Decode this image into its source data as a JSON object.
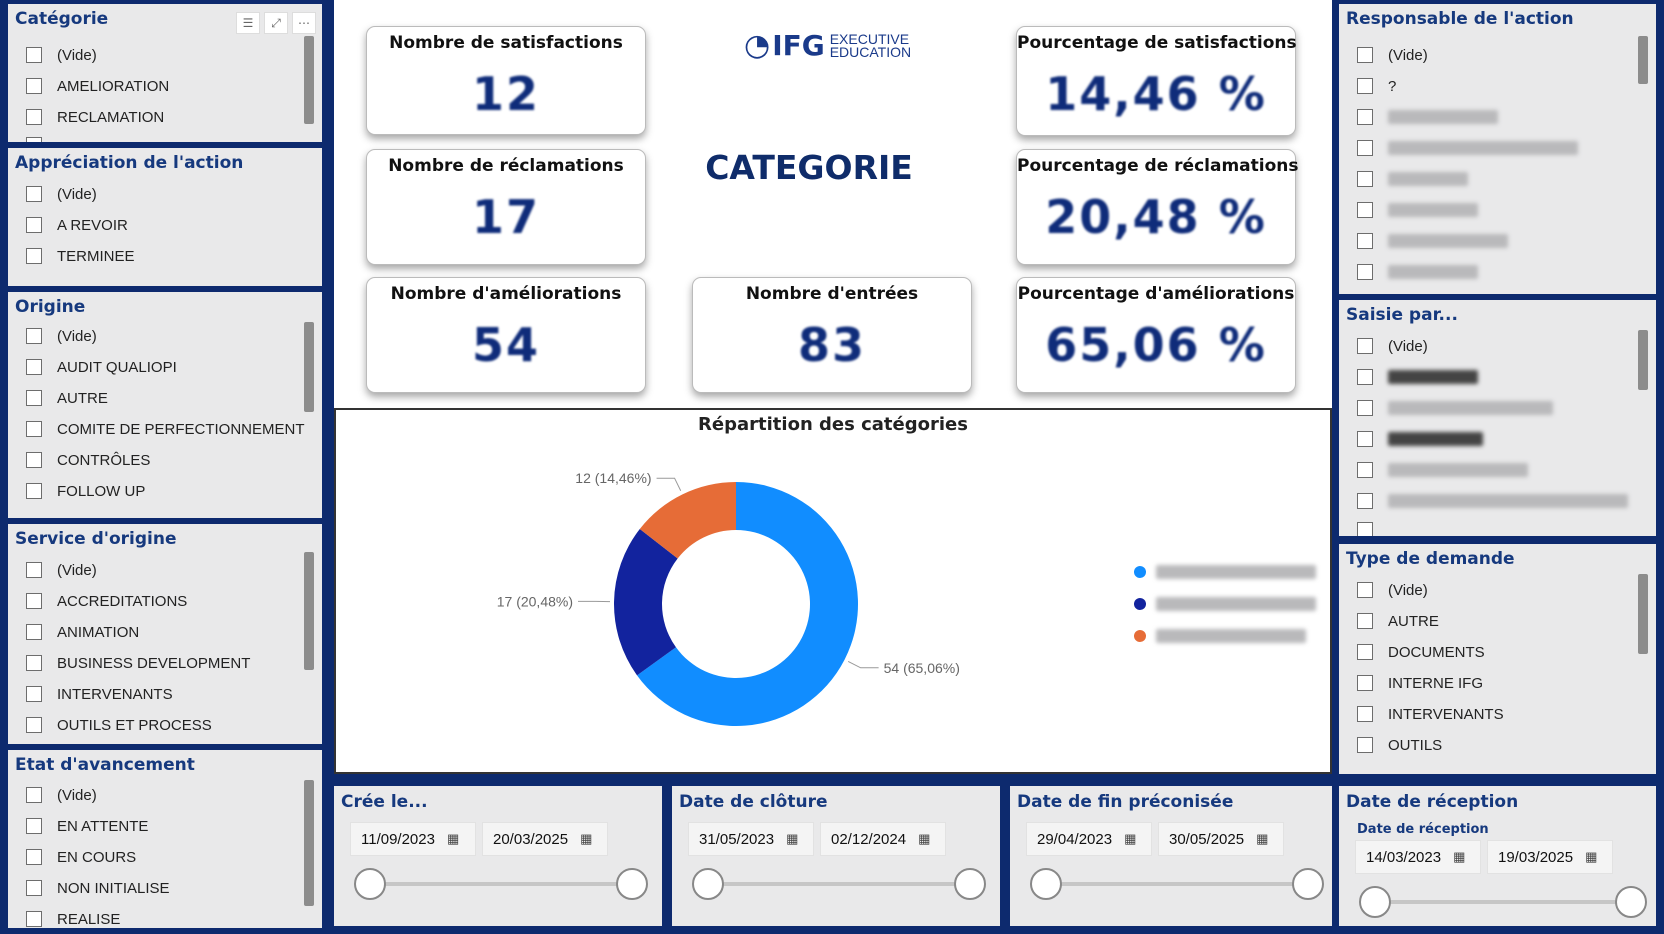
{
  "slicers": {
    "categorie": {
      "title": "Catégorie",
      "items": [
        "(Vide)",
        "AMELIORATION",
        "RECLAMATION"
      ]
    },
    "appreciation": {
      "title": "Appréciation de l'action",
      "items": [
        "(Vide)",
        "A REVOIR",
        "TERMINEE"
      ]
    },
    "origine": {
      "title": "Origine",
      "items": [
        "(Vide)",
        "AUDIT QUALIOPI",
        "AUTRE",
        "COMITE DE PERFECTIONNEMENT",
        "CONTRÔLES",
        "FOLLOW UP"
      ]
    },
    "service": {
      "title": "Service d'origine",
      "items": [
        "(Vide)",
        "ACCREDITATIONS",
        "ANIMATION",
        "BUSINESS DEVELOPMENT",
        "INTERVENANTS",
        "OUTILS ET PROCESS"
      ]
    },
    "etat": {
      "title": "Etat d'avancement",
      "items": [
        "(Vide)",
        "EN ATTENTE",
        "EN COURS",
        "NON INITIALISE",
        "REALISE"
      ]
    },
    "responsable": {
      "title": "Responsable de l'action",
      "items": [
        "(Vide)",
        "?"
      ]
    },
    "saisie": {
      "title": "Saisie par...",
      "items": [
        "(Vide)"
      ]
    },
    "type": {
      "title": "Type de demande",
      "items": [
        "(Vide)",
        "AUTRE",
        "DOCUMENTS",
        "INTERNE IFG",
        "INTERVENANTS",
        "OUTILS"
      ]
    }
  },
  "kpis": {
    "satisfactions": {
      "title": "Nombre de satisfactions",
      "value": "12"
    },
    "reclamations": {
      "title": "Nombre de réclamations",
      "value": "17"
    },
    "ameliorations": {
      "title": "Nombre d'améliorations",
      "value": "54"
    },
    "entrees": {
      "title": "Nombre d'entrées",
      "value": "83"
    },
    "pct_satisfactions": {
      "title": "Pourcentage de satisfactions",
      "value": "14,46 %"
    },
    "pct_reclamations": {
      "title": "Pourcentage de réclamations",
      "value": "20,48 %"
    },
    "pct_ameliorations": {
      "title": "Pourcentage d'améliorations",
      "value": "65,06 %"
    }
  },
  "logo": {
    "brand": "IFG",
    "line1": "EXECUTIVE",
    "line2": "EDUCATION"
  },
  "page_title": "CATEGORIE",
  "chart_data": {
    "type": "pie",
    "title": "Répartition des catégories",
    "values": [
      54,
      17,
      12
    ],
    "labels": [
      "54 (65,06%)",
      "17 (20,48%)",
      "12 (14,46%)"
    ],
    "colors": [
      "#118dff",
      "#12239e",
      "#e66c37"
    ],
    "donut": true
  },
  "date_filters": {
    "cree": {
      "title": "Crée le...",
      "start": "11/09/2023",
      "end": "20/03/2025"
    },
    "cloture": {
      "title": "Date de clôture",
      "start": "31/05/2023",
      "end": "02/12/2024"
    },
    "fin": {
      "title": "Date de fin préconisée",
      "start": "29/04/2023",
      "end": "30/05/2025"
    },
    "reception": {
      "title": "Date de réception",
      "subtitle": "Date de réception",
      "start": "14/03/2023",
      "end": "19/03/2025"
    }
  },
  "icons": [
    "filter-icon",
    "focus-mode-icon",
    "more-options-icon",
    "calendar-icon"
  ]
}
